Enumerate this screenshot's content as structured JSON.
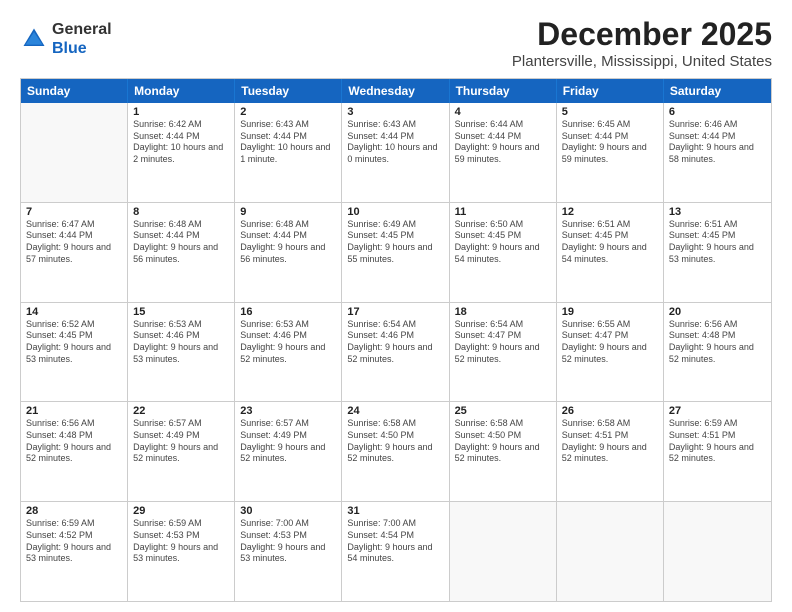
{
  "logo": {
    "general": "General",
    "blue": "Blue"
  },
  "title": "December 2025",
  "subtitle": "Plantersville, Mississippi, United States",
  "header_days": [
    "Sunday",
    "Monday",
    "Tuesday",
    "Wednesday",
    "Thursday",
    "Friday",
    "Saturday"
  ],
  "rows": [
    [
      {
        "day": "",
        "sunrise": "",
        "sunset": "",
        "daylight": "",
        "empty": true
      },
      {
        "day": "1",
        "sunrise": "Sunrise: 6:42 AM",
        "sunset": "Sunset: 4:44 PM",
        "daylight": "Daylight: 10 hours and 2 minutes."
      },
      {
        "day": "2",
        "sunrise": "Sunrise: 6:43 AM",
        "sunset": "Sunset: 4:44 PM",
        "daylight": "Daylight: 10 hours and 1 minute."
      },
      {
        "day": "3",
        "sunrise": "Sunrise: 6:43 AM",
        "sunset": "Sunset: 4:44 PM",
        "daylight": "Daylight: 10 hours and 0 minutes."
      },
      {
        "day": "4",
        "sunrise": "Sunrise: 6:44 AM",
        "sunset": "Sunset: 4:44 PM",
        "daylight": "Daylight: 9 hours and 59 minutes."
      },
      {
        "day": "5",
        "sunrise": "Sunrise: 6:45 AM",
        "sunset": "Sunset: 4:44 PM",
        "daylight": "Daylight: 9 hours and 59 minutes."
      },
      {
        "day": "6",
        "sunrise": "Sunrise: 6:46 AM",
        "sunset": "Sunset: 4:44 PM",
        "daylight": "Daylight: 9 hours and 58 minutes."
      }
    ],
    [
      {
        "day": "7",
        "sunrise": "Sunrise: 6:47 AM",
        "sunset": "Sunset: 4:44 PM",
        "daylight": "Daylight: 9 hours and 57 minutes."
      },
      {
        "day": "8",
        "sunrise": "Sunrise: 6:48 AM",
        "sunset": "Sunset: 4:44 PM",
        "daylight": "Daylight: 9 hours and 56 minutes."
      },
      {
        "day": "9",
        "sunrise": "Sunrise: 6:48 AM",
        "sunset": "Sunset: 4:44 PM",
        "daylight": "Daylight: 9 hours and 56 minutes."
      },
      {
        "day": "10",
        "sunrise": "Sunrise: 6:49 AM",
        "sunset": "Sunset: 4:45 PM",
        "daylight": "Daylight: 9 hours and 55 minutes."
      },
      {
        "day": "11",
        "sunrise": "Sunrise: 6:50 AM",
        "sunset": "Sunset: 4:45 PM",
        "daylight": "Daylight: 9 hours and 54 minutes."
      },
      {
        "day": "12",
        "sunrise": "Sunrise: 6:51 AM",
        "sunset": "Sunset: 4:45 PM",
        "daylight": "Daylight: 9 hours and 54 minutes."
      },
      {
        "day": "13",
        "sunrise": "Sunrise: 6:51 AM",
        "sunset": "Sunset: 4:45 PM",
        "daylight": "Daylight: 9 hours and 53 minutes."
      }
    ],
    [
      {
        "day": "14",
        "sunrise": "Sunrise: 6:52 AM",
        "sunset": "Sunset: 4:45 PM",
        "daylight": "Daylight: 9 hours and 53 minutes."
      },
      {
        "day": "15",
        "sunrise": "Sunrise: 6:53 AM",
        "sunset": "Sunset: 4:46 PM",
        "daylight": "Daylight: 9 hours and 53 minutes."
      },
      {
        "day": "16",
        "sunrise": "Sunrise: 6:53 AM",
        "sunset": "Sunset: 4:46 PM",
        "daylight": "Daylight: 9 hours and 52 minutes."
      },
      {
        "day": "17",
        "sunrise": "Sunrise: 6:54 AM",
        "sunset": "Sunset: 4:46 PM",
        "daylight": "Daylight: 9 hours and 52 minutes."
      },
      {
        "day": "18",
        "sunrise": "Sunrise: 6:54 AM",
        "sunset": "Sunset: 4:47 PM",
        "daylight": "Daylight: 9 hours and 52 minutes."
      },
      {
        "day": "19",
        "sunrise": "Sunrise: 6:55 AM",
        "sunset": "Sunset: 4:47 PM",
        "daylight": "Daylight: 9 hours and 52 minutes."
      },
      {
        "day": "20",
        "sunrise": "Sunrise: 6:56 AM",
        "sunset": "Sunset: 4:48 PM",
        "daylight": "Daylight: 9 hours and 52 minutes."
      }
    ],
    [
      {
        "day": "21",
        "sunrise": "Sunrise: 6:56 AM",
        "sunset": "Sunset: 4:48 PM",
        "daylight": "Daylight: 9 hours and 52 minutes."
      },
      {
        "day": "22",
        "sunrise": "Sunrise: 6:57 AM",
        "sunset": "Sunset: 4:49 PM",
        "daylight": "Daylight: 9 hours and 52 minutes."
      },
      {
        "day": "23",
        "sunrise": "Sunrise: 6:57 AM",
        "sunset": "Sunset: 4:49 PM",
        "daylight": "Daylight: 9 hours and 52 minutes."
      },
      {
        "day": "24",
        "sunrise": "Sunrise: 6:58 AM",
        "sunset": "Sunset: 4:50 PM",
        "daylight": "Daylight: 9 hours and 52 minutes."
      },
      {
        "day": "25",
        "sunrise": "Sunrise: 6:58 AM",
        "sunset": "Sunset: 4:50 PM",
        "daylight": "Daylight: 9 hours and 52 minutes."
      },
      {
        "day": "26",
        "sunrise": "Sunrise: 6:58 AM",
        "sunset": "Sunset: 4:51 PM",
        "daylight": "Daylight: 9 hours and 52 minutes."
      },
      {
        "day": "27",
        "sunrise": "Sunrise: 6:59 AM",
        "sunset": "Sunset: 4:51 PM",
        "daylight": "Daylight: 9 hours and 52 minutes."
      }
    ],
    [
      {
        "day": "28",
        "sunrise": "Sunrise: 6:59 AM",
        "sunset": "Sunset: 4:52 PM",
        "daylight": "Daylight: 9 hours and 53 minutes."
      },
      {
        "day": "29",
        "sunrise": "Sunrise: 6:59 AM",
        "sunset": "Sunset: 4:53 PM",
        "daylight": "Daylight: 9 hours and 53 minutes."
      },
      {
        "day": "30",
        "sunrise": "Sunrise: 7:00 AM",
        "sunset": "Sunset: 4:53 PM",
        "daylight": "Daylight: 9 hours and 53 minutes."
      },
      {
        "day": "31",
        "sunrise": "Sunrise: 7:00 AM",
        "sunset": "Sunset: 4:54 PM",
        "daylight": "Daylight: 9 hours and 54 minutes."
      },
      {
        "day": "",
        "sunrise": "",
        "sunset": "",
        "daylight": "",
        "empty": true
      },
      {
        "day": "",
        "sunrise": "",
        "sunset": "",
        "daylight": "",
        "empty": true
      },
      {
        "day": "",
        "sunrise": "",
        "sunset": "",
        "daylight": "",
        "empty": true
      }
    ]
  ]
}
